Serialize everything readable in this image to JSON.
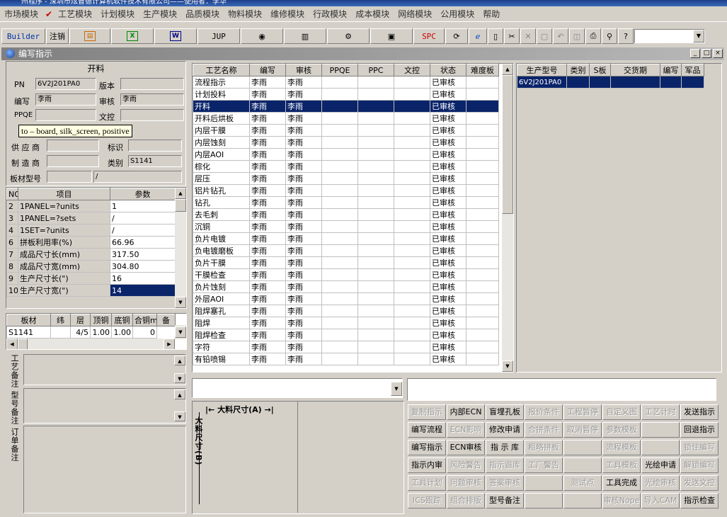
{
  "window": {
    "title": "州程序 - 深圳市炫智德计算机软件技术有限公司——使用者：李华",
    "sub_title": "编写指示"
  },
  "menu": [
    "市场模块",
    "工艺模块",
    "计划模块",
    "生产模块",
    "品质模块",
    "物料模块",
    "维修模块",
    "行政模块",
    "成本模块",
    "网络模块",
    "公用模块",
    "帮助"
  ],
  "menu_check": "✔",
  "toolbar": {
    "builder": "Builder",
    "cancel": "注销",
    "jup": "JUP",
    "spc": "SPC"
  },
  "form": {
    "section": "开料",
    "pn_label": "PN",
    "pn_value": "6V2J201PA0",
    "version_label": "版本",
    "version_value": "",
    "writer_label": "编写",
    "writer_value": "李雨",
    "review_label": "审核",
    "review_value": "李雨",
    "ppqe_label": "PPQE",
    "ppqe_value": "",
    "doc_label": "文控",
    "doc_value": "",
    "supplier_label": "供 应 商",
    "mark_label": "标识",
    "maker_label": "制 造 商",
    "class_label": "类别",
    "class_value": "S1141",
    "model_label": "板材型号",
    "model_value2": "/",
    "tooltip": "to – board, silk_screen, positive"
  },
  "params": {
    "headers": [
      "NO",
      "项目",
      "参数"
    ],
    "rows": [
      [
        "2",
        "1PANEL=?units",
        "1"
      ],
      [
        "3",
        "1PANEL=?sets",
        "/"
      ],
      [
        "4",
        "1SET=?units",
        "/"
      ],
      [
        "6",
        "拼板利用率(%)",
        "66.96"
      ],
      [
        "7",
        "成品尺寸长(mm)",
        "317.50"
      ],
      [
        "8",
        "成品尺寸宽(mm)",
        "304.80"
      ],
      [
        "9",
        "生产尺寸长(\")",
        "16"
      ],
      [
        "10",
        "生产尺寸宽(\")",
        "14"
      ]
    ]
  },
  "material": {
    "headers": [
      "板材",
      "纬",
      "层",
      "顶铜",
      "底铜",
      "合铜mm",
      "备"
    ],
    "row": [
      "S1141",
      "",
      "4/5",
      "1.00",
      "1.00",
      "0"
    ]
  },
  "remarks": [
    "工艺备注",
    "型号备注",
    "订单备注"
  ],
  "process": {
    "headers": [
      "工艺名称",
      "编写",
      "审核",
      "PPQE",
      "PPC",
      "文控",
      "状态",
      "难度板"
    ],
    "rows": [
      [
        "流程指示",
        "李雨",
        "李雨",
        "",
        "",
        "",
        "已审核",
        ""
      ],
      [
        "计划投料",
        "李雨",
        "李雨",
        "",
        "",
        "",
        "已审核",
        ""
      ],
      [
        "开料",
        "李雨",
        "李雨",
        "",
        "",
        "",
        "已审核",
        ""
      ],
      [
        "开料后烘板",
        "李雨",
        "李雨",
        "",
        "",
        "",
        "已审核",
        ""
      ],
      [
        "内层干膜",
        "李雨",
        "李雨",
        "",
        "",
        "",
        "已审核",
        ""
      ],
      [
        "内层蚀刻",
        "李雨",
        "李雨",
        "",
        "",
        "",
        "已审核",
        ""
      ],
      [
        "内层AOI",
        "李雨",
        "李雨",
        "",
        "",
        "",
        "已审核",
        ""
      ],
      [
        "棕化",
        "李雨",
        "李雨",
        "",
        "",
        "",
        "已审核",
        ""
      ],
      [
        "层压",
        "李雨",
        "李雨",
        "",
        "",
        "",
        "已审核",
        ""
      ],
      [
        "铝片钻孔",
        "李雨",
        "李雨",
        "",
        "",
        "",
        "已审核",
        ""
      ],
      [
        "钻孔",
        "李雨",
        "李雨",
        "",
        "",
        "",
        "已审核",
        ""
      ],
      [
        "去毛刺",
        "李雨",
        "李雨",
        "",
        "",
        "",
        "已审核",
        ""
      ],
      [
        "沉铜",
        "李雨",
        "李雨",
        "",
        "",
        "",
        "已审核",
        ""
      ],
      [
        "负片电镀",
        "李雨",
        "李雨",
        "",
        "",
        "",
        "已审核",
        ""
      ],
      [
        "负电镀磨板",
        "李雨",
        "李雨",
        "",
        "",
        "",
        "已审核",
        ""
      ],
      [
        "负片干膜",
        "李雨",
        "李雨",
        "",
        "",
        "",
        "已审核",
        ""
      ],
      [
        "干膜检查",
        "李雨",
        "李雨",
        "",
        "",
        "",
        "已审核",
        ""
      ],
      [
        "负片蚀刻",
        "李雨",
        "李雨",
        "",
        "",
        "",
        "已审核",
        ""
      ],
      [
        "外层AOI",
        "李雨",
        "李雨",
        "",
        "",
        "",
        "已审核",
        ""
      ],
      [
        "阻焊塞孔",
        "李雨",
        "李雨",
        "",
        "",
        "",
        "已审核",
        ""
      ],
      [
        "阻焊",
        "李雨",
        "李雨",
        "",
        "",
        "",
        "已审核",
        ""
      ],
      [
        "阻焊检查",
        "李雨",
        "李雨",
        "",
        "",
        "",
        "已审核",
        ""
      ],
      [
        "字符",
        "李雨",
        "李雨",
        "",
        "",
        "",
        "已审核",
        ""
      ],
      [
        "有铅喷锡",
        "李雨",
        "李雨",
        "",
        "",
        "",
        "已审核",
        ""
      ]
    ]
  },
  "products": {
    "headers": [
      "生产型号",
      "类别",
      "S板",
      "交货期",
      "编写",
      "军品"
    ],
    "row": [
      "6V2J201PA0",
      "",
      "",
      "",
      "",
      ""
    ]
  },
  "drawing": {
    "a_label": "大料尺寸(A)",
    "b_label": "大料尺寸(B)"
  },
  "buttons": [
    [
      "复制指示",
      "内部ECN",
      "盲埋孔板",
      "报价条件",
      "工程暂停",
      "自定义图",
      "工艺计时",
      "发送指示"
    ],
    [
      "编写流程",
      "ECN影响",
      "修改申请",
      "合拼条件",
      "取消暂停",
      "参数模板",
      "",
      "回退指示"
    ],
    [
      "编写指示",
      "ECN审核",
      "指 示 库",
      "粗略拼板",
      "",
      "流程模板",
      "",
      "锁住编写"
    ],
    [
      "指示内审",
      "风险警告",
      "指示退库",
      "工厂警告",
      "",
      "工具模板",
      "光绘申请",
      "解锁编写"
    ],
    [
      "工具计划",
      "问题审核",
      "答案审核",
      "",
      "测试点",
      "工具完成",
      "光绘审核",
      "发送文控"
    ],
    [
      "ICS跟踪",
      "组合排版",
      "型号备注",
      "",
      "",
      "审核Nope",
      "导入CAM",
      "指示检查"
    ]
  ]
}
